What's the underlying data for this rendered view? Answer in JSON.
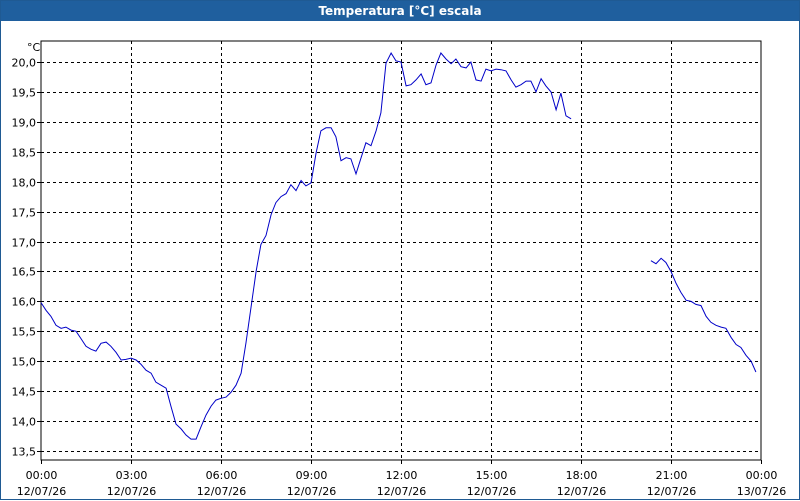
{
  "window": {
    "title": "Temperatura [°C] escala"
  },
  "chart_data": {
    "type": "line",
    "title": "Temperatura [°C] escala",
    "ylabel": "°C",
    "xlabel": "",
    "ylim": [
      13.5,
      20.5
    ],
    "xlim": [
      0,
      24
    ],
    "grid": true,
    "yticks": [
      "13,5",
      "14,0",
      "14,5",
      "15,0",
      "15,5",
      "16,0",
      "16,5",
      "17,0",
      "17,5",
      "18,0",
      "18,5",
      "19,0",
      "19,5",
      "20,0"
    ],
    "xticks": [
      {
        "time": "00:00",
        "date": "12/07/26"
      },
      {
        "time": "03:00",
        "date": "12/07/26"
      },
      {
        "time": "06:00",
        "date": "12/07/26"
      },
      {
        "time": "09:00",
        "date": "12/07/26"
      },
      {
        "time": "12:00",
        "date": "12/07/26"
      },
      {
        "time": "15:00",
        "date": "12/07/26"
      },
      {
        "time": "18:00",
        "date": "12/07/26"
      },
      {
        "time": "21:00",
        "date": "12/07/26"
      },
      {
        "time": "00:00",
        "date": "13/07/26"
      }
    ],
    "series_color": "#0000c8",
    "series": [
      {
        "name": "",
        "segments": [
          [
            [
              0.0,
              15.98
            ],
            [
              0.17,
              15.85
            ],
            [
              0.33,
              15.75
            ],
            [
              0.5,
              15.6
            ],
            [
              0.67,
              15.55
            ],
            [
              0.83,
              15.57
            ],
            [
              1.0,
              15.52
            ],
            [
              1.17,
              15.5
            ],
            [
              1.33,
              15.38
            ],
            [
              1.5,
              15.25
            ],
            [
              1.67,
              15.2
            ],
            [
              1.83,
              15.17
            ],
            [
              2.0,
              15.3
            ],
            [
              2.17,
              15.32
            ],
            [
              2.33,
              15.25
            ],
            [
              2.5,
              15.15
            ],
            [
              2.67,
              15.02
            ],
            [
              2.83,
              15.03
            ],
            [
              3.0,
              15.05
            ],
            [
              3.17,
              15.02
            ],
            [
              3.33,
              14.95
            ],
            [
              3.5,
              14.85
            ],
            [
              3.67,
              14.8
            ],
            [
              3.83,
              14.65
            ],
            [
              4.0,
              14.6
            ],
            [
              4.17,
              14.55
            ],
            [
              4.33,
              14.25
            ],
            [
              4.5,
              13.95
            ],
            [
              4.67,
              13.87
            ],
            [
              4.83,
              13.77
            ],
            [
              5.0,
              13.7
            ],
            [
              5.17,
              13.7
            ],
            [
              5.33,
              13.9
            ],
            [
              5.5,
              14.1
            ],
            [
              5.67,
              14.25
            ],
            [
              5.83,
              14.35
            ],
            [
              6.0,
              14.38
            ],
            [
              6.17,
              14.4
            ],
            [
              6.33,
              14.48
            ],
            [
              6.5,
              14.6
            ],
            [
              6.67,
              14.8
            ],
            [
              6.83,
              15.3
            ],
            [
              7.0,
              15.9
            ],
            [
              7.17,
              16.5
            ],
            [
              7.33,
              16.95
            ],
            [
              7.5,
              17.1
            ],
            [
              7.67,
              17.45
            ],
            [
              7.83,
              17.65
            ],
            [
              8.0,
              17.75
            ],
            [
              8.17,
              17.8
            ],
            [
              8.33,
              17.95
            ],
            [
              8.5,
              17.85
            ],
            [
              8.67,
              18.02
            ],
            [
              8.83,
              17.93
            ],
            [
              9.0,
              17.98
            ],
            [
              9.17,
              18.48
            ],
            [
              9.33,
              18.85
            ],
            [
              9.5,
              18.9
            ],
            [
              9.67,
              18.9
            ],
            [
              9.83,
              18.75
            ],
            [
              10.0,
              18.35
            ],
            [
              10.17,
              18.4
            ],
            [
              10.33,
              18.38
            ],
            [
              10.5,
              18.13
            ],
            [
              10.67,
              18.4
            ],
            [
              10.83,
              18.65
            ],
            [
              11.0,
              18.6
            ],
            [
              11.17,
              18.85
            ],
            [
              11.33,
              19.15
            ],
            [
              11.5,
              19.98
            ],
            [
              11.67,
              20.15
            ],
            [
              11.83,
              20.02
            ],
            [
              12.0,
              20.0
            ],
            [
              12.17,
              19.6
            ],
            [
              12.33,
              19.62
            ],
            [
              12.5,
              19.7
            ],
            [
              12.67,
              19.8
            ],
            [
              12.83,
              19.62
            ],
            [
              13.0,
              19.65
            ],
            [
              13.17,
              19.95
            ],
            [
              13.33,
              20.15
            ],
            [
              13.5,
              20.05
            ],
            [
              13.67,
              19.97
            ],
            [
              13.83,
              20.05
            ],
            [
              14.0,
              19.92
            ],
            [
              14.17,
              19.9
            ],
            [
              14.33,
              20.0
            ],
            [
              14.5,
              19.7
            ],
            [
              14.67,
              19.68
            ],
            [
              14.83,
              19.88
            ],
            [
              15.0,
              19.85
            ],
            [
              15.17,
              19.88
            ],
            [
              15.33,
              19.87
            ],
            [
              15.5,
              19.85
            ],
            [
              15.67,
              19.7
            ],
            [
              15.83,
              19.58
            ],
            [
              16.0,
              19.62
            ],
            [
              16.17,
              19.68
            ],
            [
              16.33,
              19.68
            ],
            [
              16.5,
              19.5
            ],
            [
              16.67,
              19.72
            ],
            [
              16.83,
              19.6
            ],
            [
              17.0,
              19.5
            ],
            [
              17.17,
              19.2
            ],
            [
              17.33,
              19.48
            ],
            [
              17.5,
              19.1
            ],
            [
              17.67,
              19.05
            ]
          ],
          [
            [
              20.33,
              16.68
            ],
            [
              20.5,
              16.63
            ],
            [
              20.67,
              16.72
            ],
            [
              20.83,
              16.65
            ],
            [
              21.0,
              16.5
            ],
            [
              21.17,
              16.3
            ],
            [
              21.33,
              16.15
            ],
            [
              21.5,
              16.02
            ],
            [
              21.67,
              16.0
            ],
            [
              21.83,
              15.95
            ],
            [
              22.0,
              15.93
            ],
            [
              22.17,
              15.75
            ],
            [
              22.33,
              15.65
            ],
            [
              22.5,
              15.6
            ],
            [
              22.67,
              15.57
            ],
            [
              22.83,
              15.55
            ],
            [
              23.0,
              15.4
            ],
            [
              23.17,
              15.28
            ],
            [
              23.33,
              15.23
            ],
            [
              23.5,
              15.1
            ],
            [
              23.67,
              15.0
            ],
            [
              23.83,
              14.82
            ]
          ]
        ]
      }
    ]
  }
}
